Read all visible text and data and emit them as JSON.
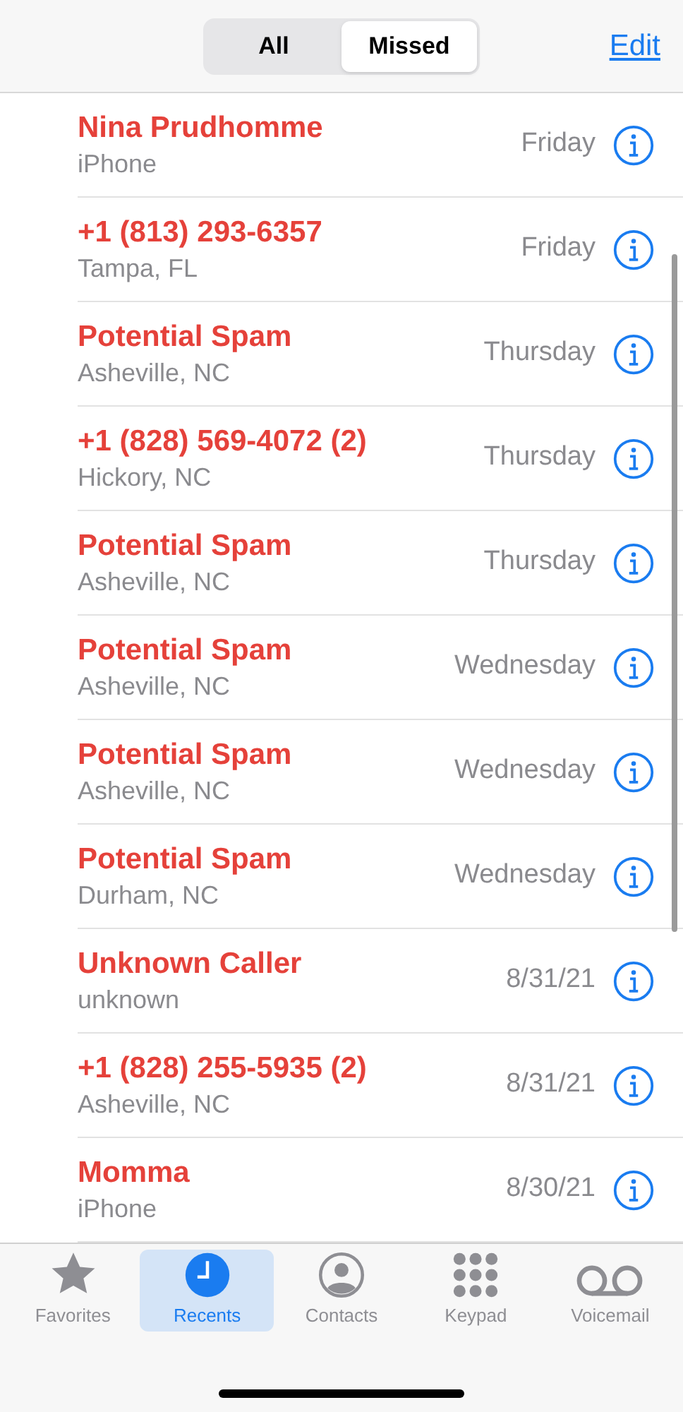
{
  "segments": [
    {
      "label": "All",
      "selected": false
    },
    {
      "label": "Missed",
      "selected": true
    }
  ],
  "edit_link": "Edit",
  "calls": [
    {
      "name": "Nina Prudhomme",
      "detail": "iPhone",
      "when": "Friday"
    },
    {
      "name": "+1 (813) 293-6357",
      "detail": "Tampa, FL",
      "when": "Friday"
    },
    {
      "name": "Potential Spam",
      "detail": "Asheville, NC",
      "when": "Thursday"
    },
    {
      "name": "+1 (828) 569-4072 (2)",
      "detail": "Hickory, NC",
      "when": "Thursday"
    },
    {
      "name": "Potential Spam",
      "detail": "Asheville, NC",
      "when": "Thursday"
    },
    {
      "name": "Potential Spam",
      "detail": "Asheville, NC",
      "when": "Wednesday"
    },
    {
      "name": "Potential Spam",
      "detail": "Asheville, NC",
      "when": "Wednesday"
    },
    {
      "name": "Potential Spam",
      "detail": "Durham, NC",
      "when": "Wednesday"
    },
    {
      "name": "Unknown Caller",
      "detail": "unknown",
      "when": "8/31/21"
    },
    {
      "name": "+1 (828) 255-5935 (2)",
      "detail": "Asheville, NC",
      "when": "8/31/21"
    },
    {
      "name": "Momma",
      "detail": "iPhone",
      "when": "8/30/21"
    }
  ],
  "tab_bar": [
    {
      "kind": "favorites",
      "label": "Favorites",
      "selected": false
    },
    {
      "kind": "recents",
      "label": "Recents",
      "selected": true
    },
    {
      "kind": "contacts",
      "label": "Contacts",
      "selected": false
    },
    {
      "kind": "keypad",
      "label": "Keypad",
      "selected": false
    },
    {
      "kind": "voicemail",
      "label": "Voicemail",
      "selected": false
    }
  ]
}
